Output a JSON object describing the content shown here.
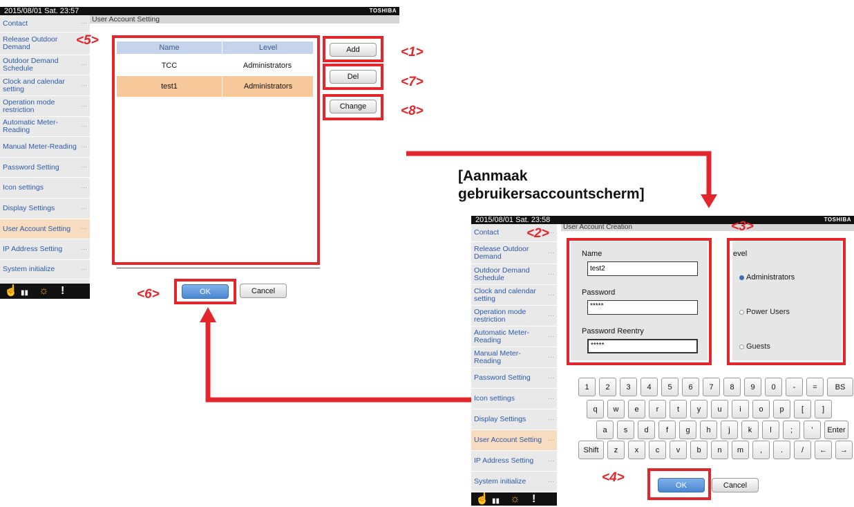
{
  "screen1": {
    "datetime": "2015/08/01  Sat.  23:57",
    "brand": "TOSHIBA",
    "title": "User Account Setting",
    "sidebar": [
      {
        "label": "Contact"
      },
      {
        "label": "Release Outdoor Demand"
      },
      {
        "label": "Outdoor Demand Schedule"
      },
      {
        "label": "Clock and calendar setting"
      },
      {
        "label": "Operation mode restriction"
      },
      {
        "label": "Automatic Meter-Reading"
      },
      {
        "label": "Manual Meter-Reading"
      },
      {
        "label": "Password Setting"
      },
      {
        "label": "Icon settings"
      },
      {
        "label": "Display Settings"
      },
      {
        "label": "User Account Setting"
      },
      {
        "label": "IP Address Setting"
      },
      {
        "label": "System initialize"
      }
    ],
    "table": {
      "headers": [
        "Name",
        "Level"
      ],
      "rows": [
        [
          "TCC",
          "Administrators"
        ],
        [
          "test1",
          "Administrators"
        ]
      ]
    },
    "buttons": {
      "add": "Add",
      "del": "Del",
      "change": "Change",
      "ok": "OK",
      "cancel": "Cancel"
    },
    "callouts": {
      "c1": "<1>",
      "c5": "<5>",
      "c6": "<6>",
      "c7": "<7>",
      "c8": "<8>"
    }
  },
  "caption": {
    "line1": "[Aanmaak",
    "line2": "gebruikersaccountscherm]"
  },
  "screen2": {
    "datetime": "2015/08/01  Sat.  23:58",
    "brand": "TOSHIBA",
    "title": "User Account Creation",
    "sidebar": [
      {
        "label": "Contact"
      },
      {
        "label": "Release Outdoor Demand"
      },
      {
        "label": "Outdoor Demand Schedule"
      },
      {
        "label": "Clock and calendar setting"
      },
      {
        "label": "Operation mode restriction"
      },
      {
        "label": "Automatic Meter-Reading"
      },
      {
        "label": "Manual Meter-Reading"
      },
      {
        "label": "Password Setting"
      },
      {
        "label": "Icon settings"
      },
      {
        "label": "Display Settings"
      },
      {
        "label": "User Account Setting"
      },
      {
        "label": "IP Address Setting"
      },
      {
        "label": "System initialize"
      }
    ],
    "form": {
      "name_label": "Name",
      "name_value": "test2",
      "password_label": "Password",
      "password_value": "*****",
      "reentry_label": "Password Reentry",
      "reentry_value": "*****"
    },
    "level": {
      "label": "evel",
      "options": [
        "Administrators",
        "Power Users",
        "Guests"
      ],
      "selected": "Administrators"
    },
    "keyboard": {
      "row1": [
        "1",
        "2",
        "3",
        "4",
        "5",
        "6",
        "7",
        "8",
        "9",
        "0",
        "-",
        "=",
        "BS"
      ],
      "row2": [
        "q",
        "w",
        "e",
        "r",
        "t",
        "y",
        "u",
        "i",
        "o",
        "p",
        "[",
        "]"
      ],
      "row3": [
        "a",
        "s",
        "d",
        "f",
        "g",
        "h",
        "j",
        "k",
        "l",
        ";",
        "'",
        "Enter"
      ],
      "row4": [
        "Shift",
        "z",
        "x",
        "c",
        "v",
        "b",
        "n",
        "m",
        ",",
        ".",
        "/",
        "←",
        "→"
      ]
    },
    "buttons": {
      "ok": "OK",
      "cancel": "Cancel"
    },
    "callouts": {
      "c2": "<2>",
      "c3": "<3>",
      "c4": "<4>"
    }
  },
  "colors": {
    "accent_red": "#e3262b",
    "selected_row": "#f7c99a",
    "header_blue": "#c5d4ea",
    "link_blue": "#2a5aa8"
  }
}
